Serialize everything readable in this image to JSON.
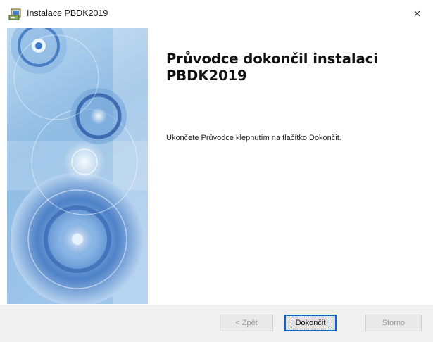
{
  "window": {
    "title": "Instalace PBDK2019",
    "close_glyph": "×",
    "app_icon": "installer-icon"
  },
  "wizard": {
    "heading": "Průvodce dokončil instalaci PBDK2019",
    "message": "Ukončete Průvodce klepnutím na tlačítko Dokončit."
  },
  "buttons": {
    "back": {
      "label": "< Zpět",
      "enabled": false
    },
    "finish": {
      "label": "Dokončit",
      "enabled": true,
      "focused": true
    },
    "cancel": {
      "label": "Storno",
      "enabled": false
    }
  },
  "colors": {
    "panel_blue": "#9fc7e8",
    "focus_border": "#0a64c8",
    "footer_bg": "#f0f0f0"
  }
}
